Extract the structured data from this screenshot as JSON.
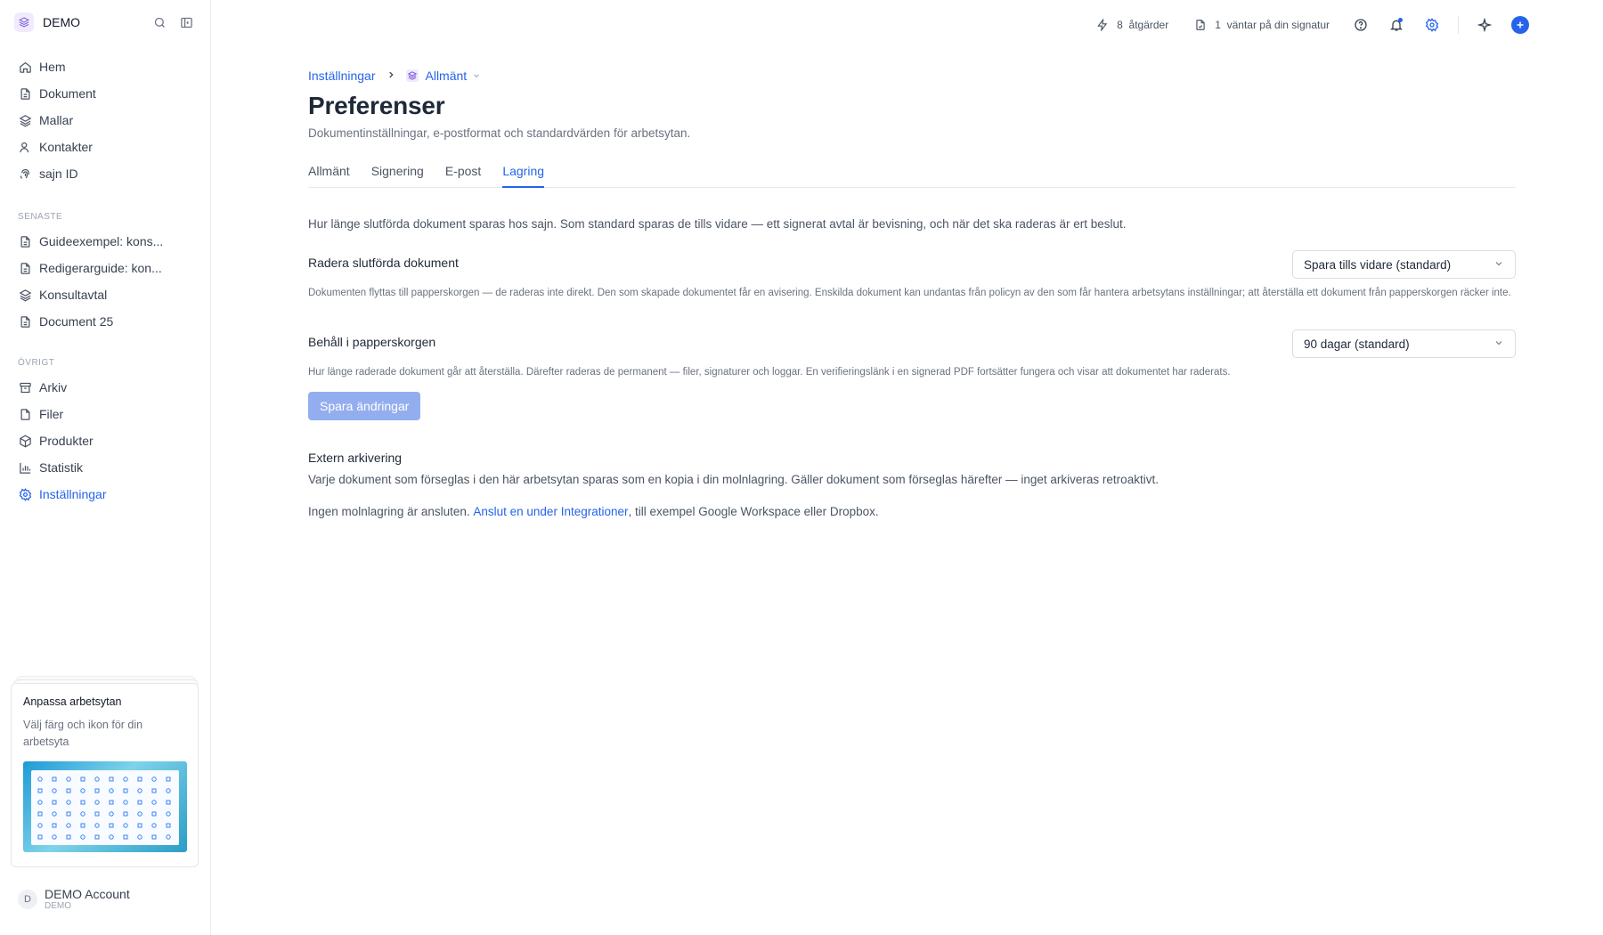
{
  "colors": {
    "accent": "#2563eb",
    "disabled_button": "#93aeef"
  },
  "workspace": {
    "name": "DEMO"
  },
  "sidebar": {
    "main_items": [
      {
        "label": "Hem",
        "icon": "home-icon"
      },
      {
        "label": "Dokument",
        "icon": "document-icon"
      },
      {
        "label": "Mallar",
        "icon": "layers-icon"
      },
      {
        "label": "Kontakter",
        "icon": "contacts-icon"
      },
      {
        "label": "sajn ID",
        "icon": "fingerprint-icon"
      }
    ],
    "recent_heading": "SENASTE",
    "recent_items": [
      {
        "label": "Guideexempel: kons...",
        "icon": "document-icon"
      },
      {
        "label": "Redigerarguide: kon...",
        "icon": "document-icon"
      },
      {
        "label": "Konsultavtal",
        "icon": "layers-icon"
      },
      {
        "label": "Document 25",
        "icon": "document-icon"
      }
    ],
    "other_heading": "ÖVRIGT",
    "other_items": [
      {
        "label": "Arkiv",
        "icon": "archive-icon"
      },
      {
        "label": "Filer",
        "icon": "file-icon"
      },
      {
        "label": "Produkter",
        "icon": "box-icon"
      },
      {
        "label": "Statistik",
        "icon": "chart-icon"
      },
      {
        "label": "Inställningar",
        "icon": "gear-icon",
        "active": true
      }
    ],
    "promo": {
      "title": "Anpassa arbetsytan",
      "description": "Välj färg och ikon för din arbetsyta"
    },
    "account": {
      "initial": "D",
      "name": "DEMO Account",
      "workspace": "DEMO"
    }
  },
  "topbar": {
    "actions_count": "8",
    "actions_label": "åtgärder",
    "signature_count": "1",
    "signature_label": "väntar på din signatur"
  },
  "breadcrumb": {
    "parent": "Inställningar",
    "current": "Allmänt"
  },
  "page": {
    "title": "Preferenser",
    "subtitle": "Dokumentinställningar, e-postformat och standardvärden för arbetsytan."
  },
  "tabs": [
    {
      "label": "Allmänt"
    },
    {
      "label": "Signering"
    },
    {
      "label": "E-post"
    },
    {
      "label": "Lagring",
      "active": true
    }
  ],
  "storage": {
    "intro": "Hur länge slutförda dokument sparas hos sajn. Som standard sparas de tills vidare — ett signerat avtal är bevisning, och när det ska raderas är ert beslut.",
    "delete_label": "Radera slutförda dokument",
    "delete_value": "Spara tills vidare (standard)",
    "delete_help": "Dokumenten flyttas till papperskorgen — de raderas inte direkt. Den som skapade dokumentet får en avisering. Enskilda dokument kan undantas från policyn av den som får hantera arbetsytans inställningar; att återställa ett dokument från papperskorgen räcker inte.",
    "trash_label": "Behåll i papperskorgen",
    "trash_value": "90 dagar (standard)",
    "trash_help": "Hur länge raderade dokument går att återställa. Därefter raderas de permanent — filer, signaturer och loggar. En verifieringslänk i en signerad PDF fortsätter fungera och visar att dokumentet har raderats.",
    "save_label": "Spara ändringar"
  },
  "external": {
    "title": "Extern arkivering",
    "description": "Varje dokument som förseglas i den här arbetsytan sparas som en kopia i din molnlagring. Gäller dokument som förseglas härefter — inget arkiveras retroaktivt.",
    "note_prefix": "Ingen molnlagring är ansluten. ",
    "note_link": "Anslut en under Integrationer",
    "note_suffix": ", till exempel Google Workspace eller Dropbox."
  }
}
